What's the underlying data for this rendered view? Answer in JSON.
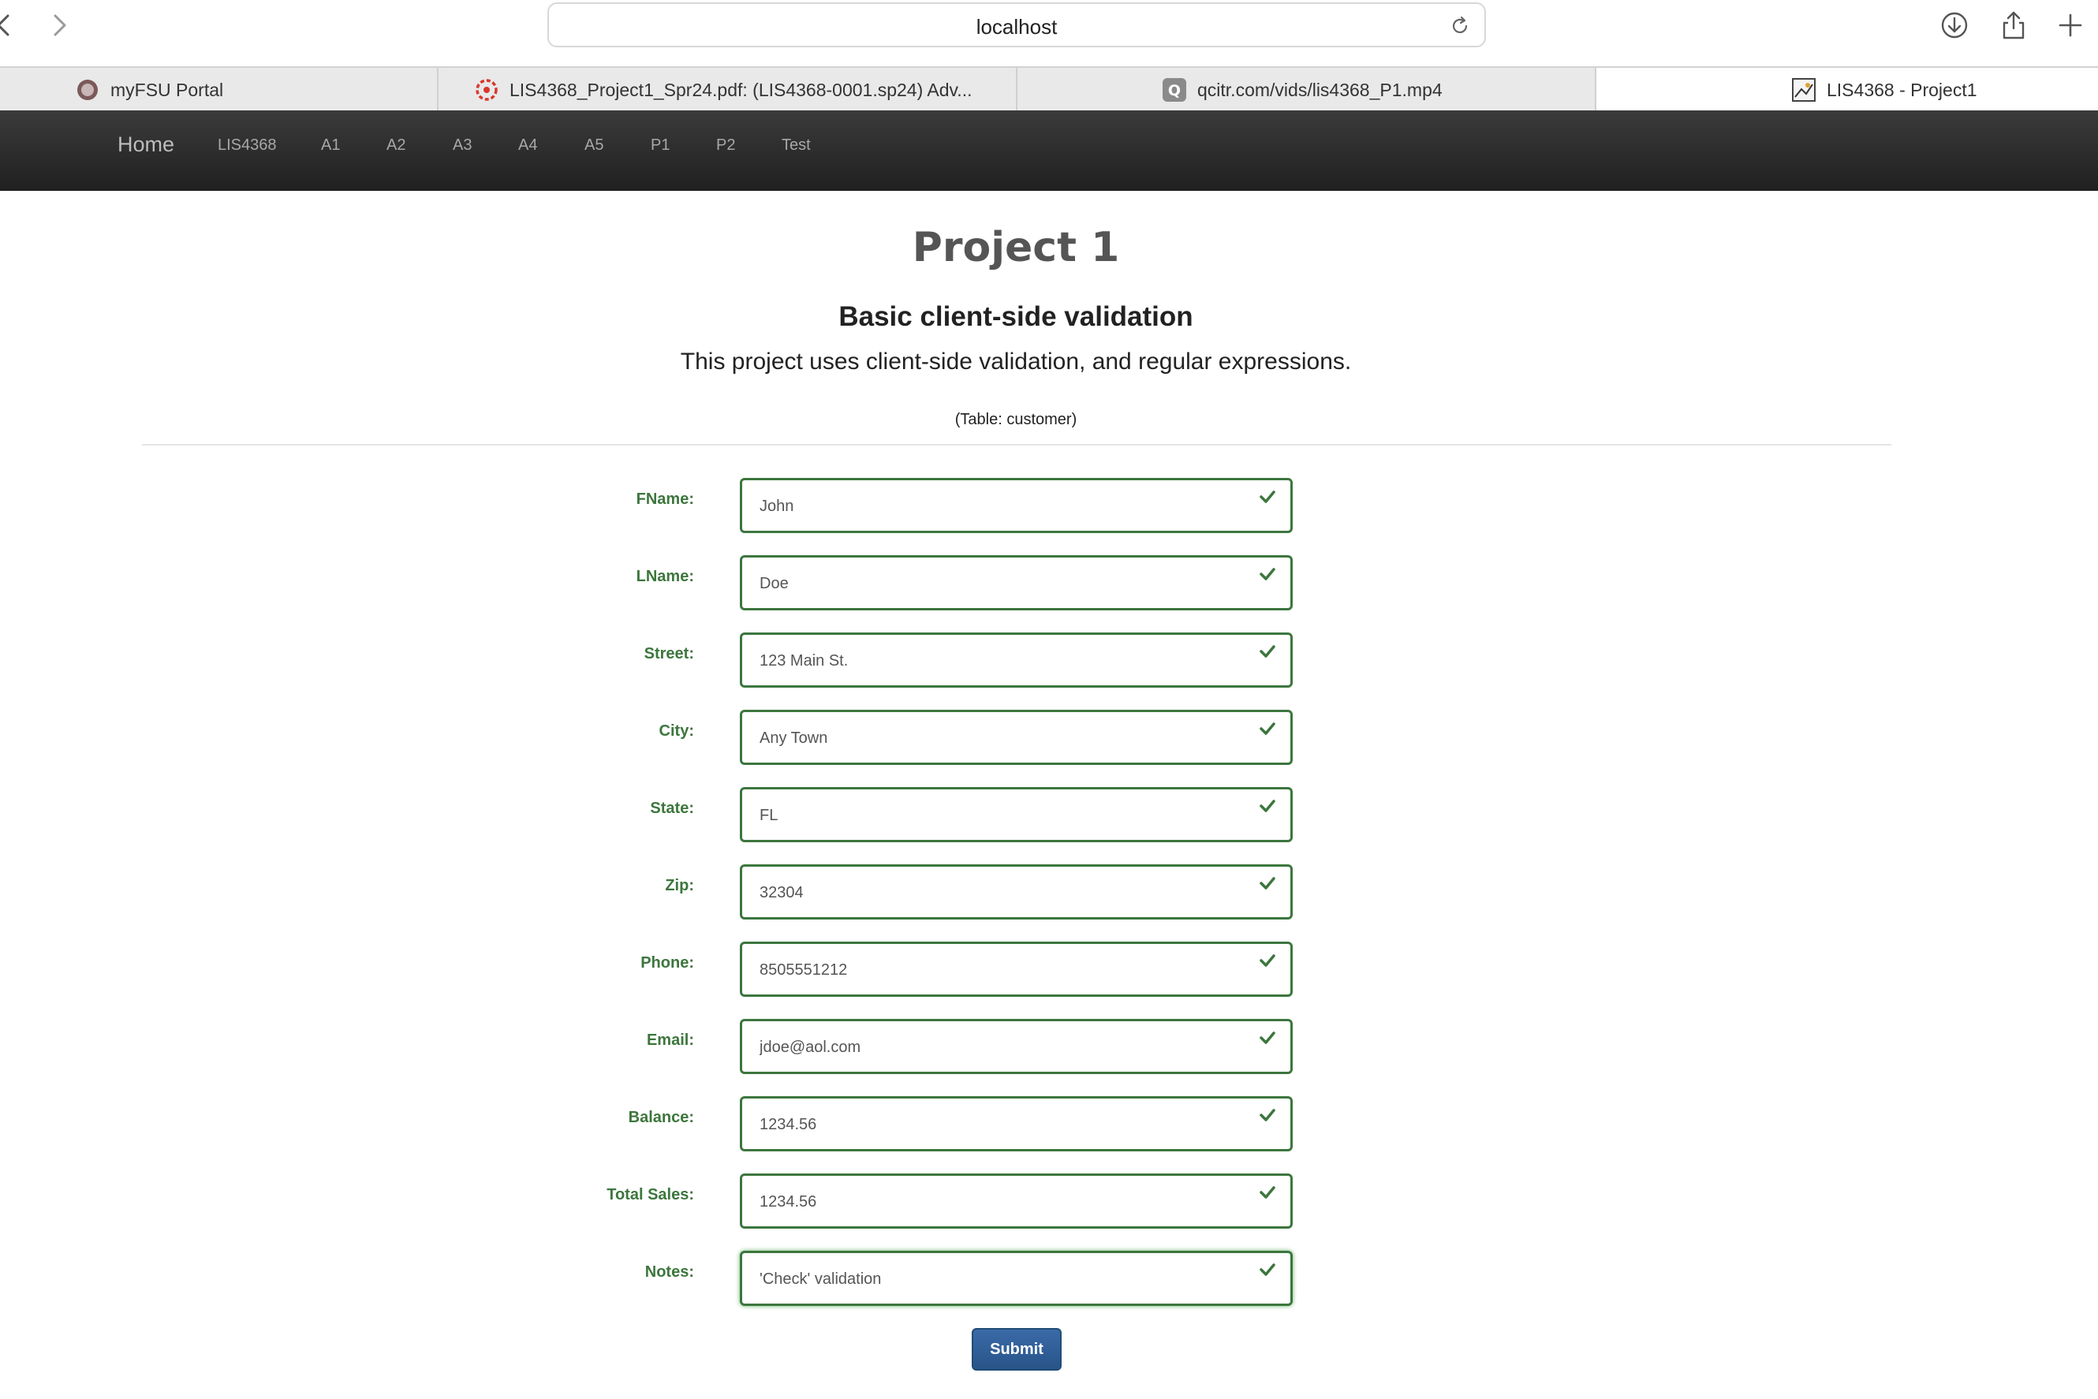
{
  "browser": {
    "url": "localhost",
    "tabs": [
      {
        "label": "myFSU Portal"
      },
      {
        "label": "LIS4368_Project1_Spr24.pdf: (LIS4368-0001.sp24) Adv..."
      },
      {
        "label": "qcitr.com/vids/lis4368_P1.mp4"
      },
      {
        "label": "LIS4368 - Project1"
      }
    ]
  },
  "sitenav": {
    "brand": "Home",
    "links": [
      "LIS4368",
      "A1",
      "A2",
      "A3",
      "A4",
      "A5",
      "P1",
      "P2",
      "Test"
    ]
  },
  "page": {
    "title": "Project 1",
    "subtitle": "Basic client-side validation",
    "lead": "This project uses client-side validation, and regular expressions.",
    "table_note": "(Table: customer)"
  },
  "form": {
    "fields": [
      {
        "label": "FName:",
        "value": "John"
      },
      {
        "label": "LName:",
        "value": "Doe"
      },
      {
        "label": "Street:",
        "value": "123 Main St."
      },
      {
        "label": "City:",
        "value": "Any Town"
      },
      {
        "label": "State:",
        "value": "FL"
      },
      {
        "label": "Zip:",
        "value": "32304"
      },
      {
        "label": "Phone:",
        "value": "8505551212"
      },
      {
        "label": "Email:",
        "value": "jdoe@aol.com"
      },
      {
        "label": "Balance:",
        "value": "1234.56"
      },
      {
        "label": "Total Sales:",
        "value": "1234.56"
      },
      {
        "label": "Notes:",
        "value": "'Check' validation"
      }
    ],
    "submit_label": "Submit"
  },
  "colors": {
    "valid": "#3c763d",
    "primary": "#285489",
    "navbar": "#2a2a2a"
  },
  "icons": {
    "back": "chevron-left-icon",
    "forward": "chevron-right-icon",
    "reload": "reload-icon",
    "download": "download-icon",
    "share": "share-icon",
    "new_tab": "plus-icon",
    "field_status": "checkmark-icon"
  }
}
